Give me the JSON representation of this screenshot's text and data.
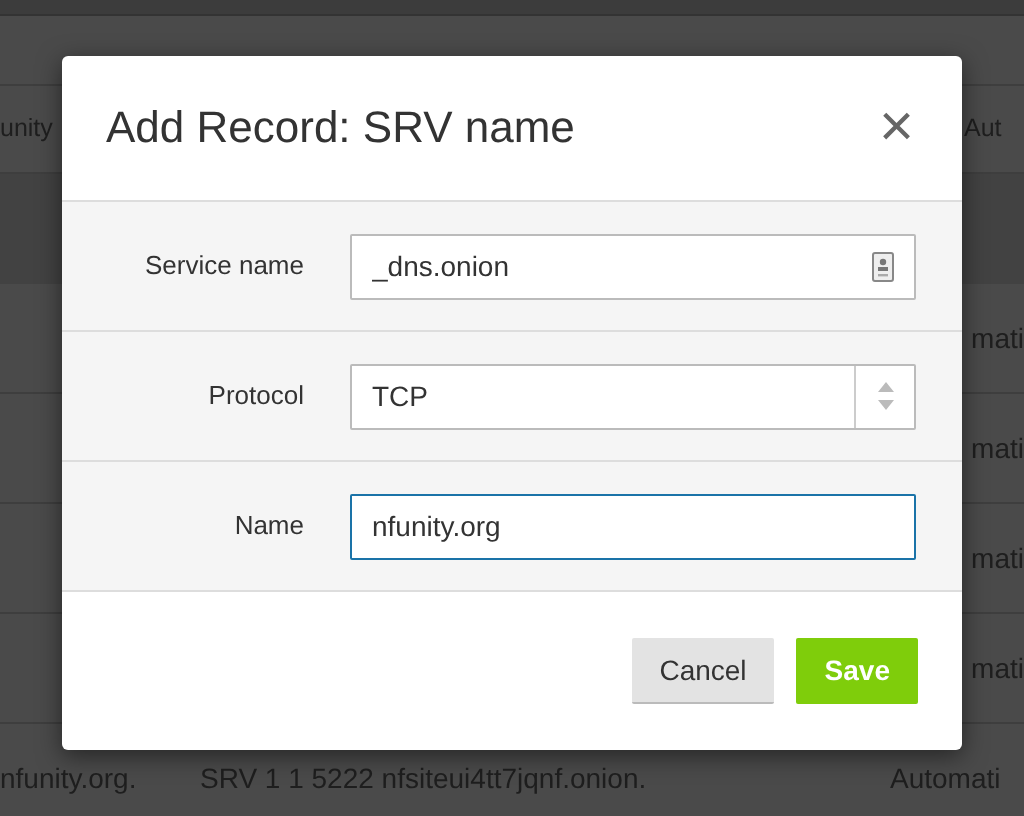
{
  "background_table": {
    "rows": [
      {
        "left": "unity",
        "middle": "",
        "right": "Aut"
      },
      {
        "left": "",
        "middle": "",
        "right": "mati"
      },
      {
        "left": "",
        "middle": "",
        "right": "mati"
      },
      {
        "left": "",
        "middle": "",
        "right": "mati"
      },
      {
        "left": "",
        "middle": "",
        "right": "mati"
      },
      {
        "left": "nfunity.org.",
        "middle": "SRV 1 1 5222 nfsiteui4tt7jqnf.onion.",
        "right": "Automati"
      }
    ]
  },
  "dialog": {
    "title": "Add Record: SRV name",
    "close": "×",
    "fields": [
      {
        "kind": "text-with-icon",
        "label": "Service name",
        "value": "_dns.onion",
        "focused": false
      },
      {
        "kind": "select",
        "label": "Protocol",
        "value": "TCP",
        "focused": false
      },
      {
        "kind": "text",
        "label": "Name",
        "value": "nfunity.org",
        "focused": true
      }
    ],
    "buttons": [
      {
        "label": "Cancel",
        "primary": false
      },
      {
        "label": "Save",
        "primary": true
      }
    ]
  }
}
